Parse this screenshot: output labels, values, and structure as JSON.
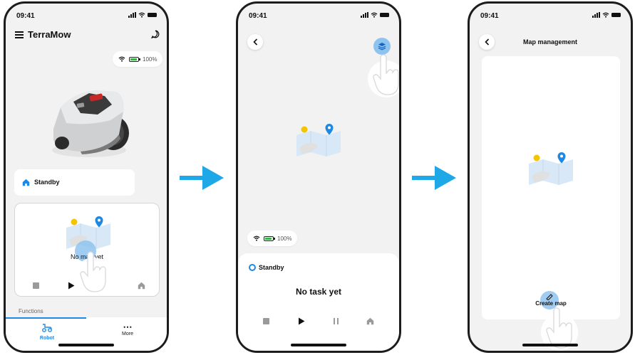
{
  "status_bar": {
    "time": "09:41"
  },
  "screen1": {
    "app_title": "TerraMow",
    "battery_percent": "100%",
    "state_card_label": "Standby",
    "map_card_text": "No map yet",
    "functions_label": "Functions",
    "nav": [
      {
        "label": "Robot"
      },
      {
        "label": "More"
      }
    ]
  },
  "screen2": {
    "battery_percent": "100%",
    "state_label": "Standby",
    "task_text": "No task yet"
  },
  "screen3": {
    "title": "Map management",
    "create_map_label": "Create map"
  },
  "colors": {
    "accent": "#1e88e5",
    "flow_arrow": "#1ea8e8",
    "battery_green": "#3ab54a",
    "touch_highlight": "#8fc3ef"
  }
}
